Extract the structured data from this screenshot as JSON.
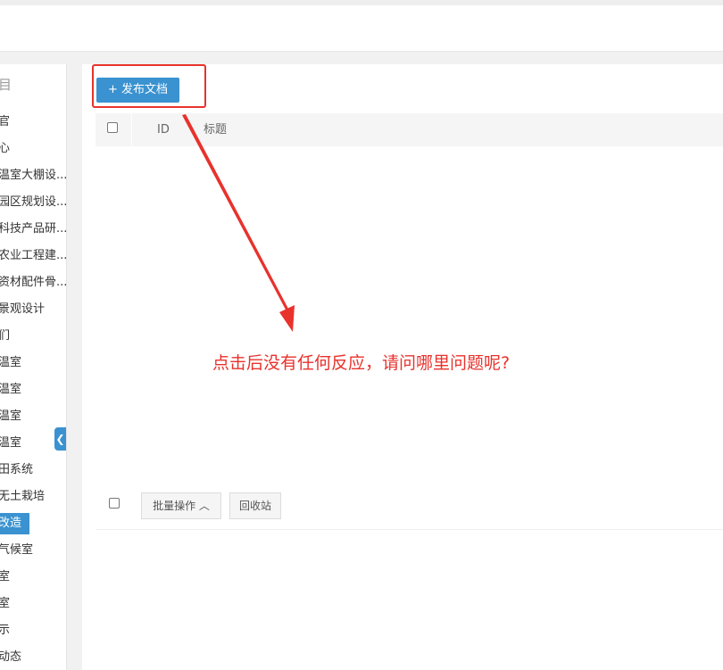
{
  "sidebar": {
    "title": "目",
    "items": [
      {
        "label": "官"
      },
      {
        "label": "心"
      },
      {
        "label": "温室大棚设..."
      },
      {
        "label": "园区规划设..."
      },
      {
        "label": "科技产品研..."
      },
      {
        "label": "农业工程建..."
      },
      {
        "label": "资材配件骨..."
      },
      {
        "label": "景观设计"
      },
      {
        "label": "们"
      },
      {
        "label": "温室"
      },
      {
        "label": "温室"
      },
      {
        "label": "温室"
      },
      {
        "label": "温室"
      },
      {
        "label": "田系统"
      },
      {
        "label": "无土栽培"
      },
      {
        "label": "改造"
      },
      {
        "label": "气候室"
      },
      {
        "label": "室"
      },
      {
        "label": "室"
      },
      {
        "label": "示"
      },
      {
        "label": "动态"
      }
    ],
    "active_index": 15,
    "collapse_icon": "chevron-left-icon"
  },
  "toolbar": {
    "publish_label": "+ 发布文档"
  },
  "table": {
    "columns": [
      "ID",
      "标题"
    ]
  },
  "footer": {
    "batch_label": "批量操作 ︿",
    "recycle_label": "回收站"
  },
  "annotation": {
    "text": "点击后没有任何反应，请问哪里问题呢?",
    "color": "#e8322c"
  },
  "colors": {
    "accent": "#3a92d0",
    "annotation": "#e8322c"
  }
}
